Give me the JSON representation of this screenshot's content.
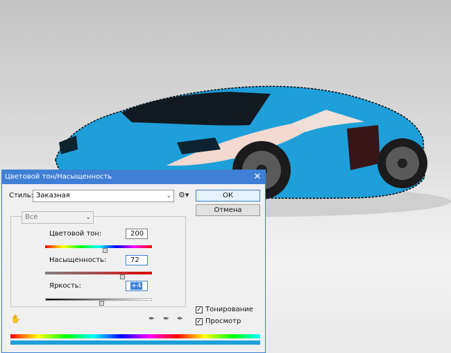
{
  "dialog": {
    "title": "Цветовой тон/Насыщенность",
    "close_glyph": "✕",
    "style_label": "Стиль:",
    "style_value": "Заказная",
    "ok_label": "ОК",
    "cancel_label": "Отмена",
    "channel_value": "Все",
    "hue_label": "Цветовой тон:",
    "hue_value": "200",
    "saturation_label": "Насыщенность:",
    "saturation_value": "72",
    "lightness_label": "Яркость:",
    "lightness_value": "+4",
    "colorize_label": "Тонирование",
    "preview_label": "Просмотр",
    "colorize_checked": true,
    "preview_checked": true
  },
  "sliders": {
    "hue_fraction": 0.56,
    "saturation_fraction": 0.72,
    "lightness_fraction": 0.52
  },
  "icons": {
    "settings": "gear-icon",
    "target_adjust": "hand-icon",
    "eyedroppers": [
      "eyedropper-icon",
      "eyedropper-plus-icon",
      "eyedropper-minus-icon"
    ]
  },
  "colors": {
    "car_body": "#1e9fd9",
    "title_bar": "#3f80d6",
    "result_bar": "#1e9fd9"
  }
}
